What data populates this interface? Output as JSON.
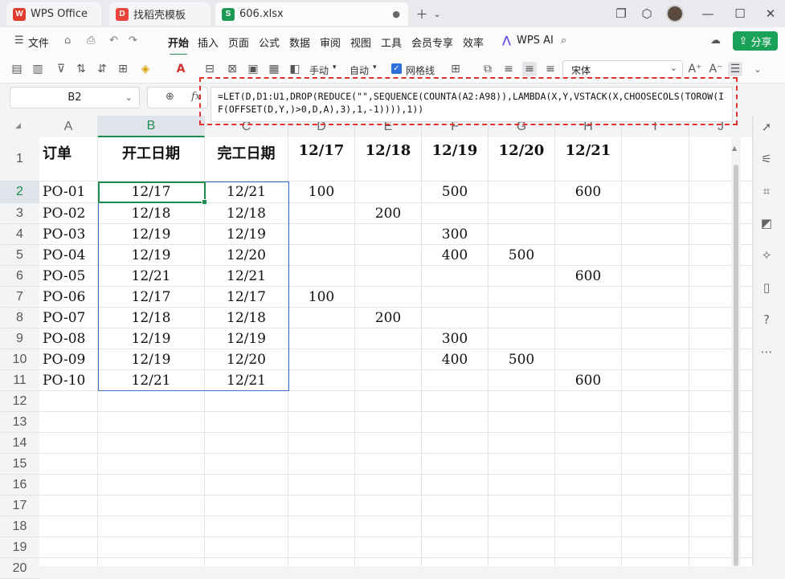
{
  "tabs": [
    {
      "label": "WPS Office",
      "icon": "wps-logo-icon"
    },
    {
      "label": "找稻壳模板",
      "icon": "docer-icon"
    },
    {
      "label": "606.xlsx",
      "icon": "spreadsheet-icon"
    }
  ],
  "menu": {
    "file": "文件",
    "items": [
      "开始",
      "插入",
      "页面",
      "公式",
      "数据",
      "审阅",
      "视图",
      "工具",
      "会员专享",
      "效率"
    ],
    "ai": "WPS AI",
    "share": "分享"
  },
  "toolbar": {
    "wrap": "手动",
    "auto": "自动",
    "gridlines": "网格线",
    "font": "宋体"
  },
  "formula_bar": {
    "name_box": "B2",
    "fx": "fx",
    "formula": "=LET(D,D1:U1,DROP(REDUCE(\"\",SEQUENCE(COUNTA(A2:A98)),LAMBDA(X,Y,VSTACK(X,CHOOSECOLS(TOROW(IF(OFFSET(D,Y,)>0,D,A),3),1,-1)))),1))"
  },
  "columns": [
    "A",
    "B",
    "C",
    "D",
    "E",
    "F",
    "G",
    "H",
    "I",
    "J"
  ],
  "rows": [
    "1",
    "2",
    "3",
    "4",
    "5",
    "6",
    "7",
    "8",
    "9",
    "10",
    "11",
    "12",
    "13",
    "14",
    "15",
    "16",
    "17",
    "18",
    "19",
    "20"
  ],
  "header_row": [
    "订单",
    "开工日期",
    "完工日期",
    "12/17",
    "12/18",
    "12/19",
    "12/20",
    "12/21"
  ],
  "data_rows": [
    [
      "PO-01",
      "12/17",
      "12/21",
      "100",
      "",
      "500",
      "",
      "600"
    ],
    [
      "PO-02",
      "12/18",
      "12/18",
      "",
      "200",
      "",
      "",
      ""
    ],
    [
      "PO-03",
      "12/19",
      "12/19",
      "",
      "",
      "300",
      "",
      ""
    ],
    [
      "PO-04",
      "12/19",
      "12/20",
      "",
      "",
      "400",
      "500",
      ""
    ],
    [
      "PO-05",
      "12/21",
      "12/21",
      "",
      "",
      "",
      "",
      "600"
    ],
    [
      "PO-06",
      "12/17",
      "12/17",
      "100",
      "",
      "",
      "",
      ""
    ],
    [
      "PO-07",
      "12/18",
      "12/18",
      "",
      "200",
      "",
      "",
      ""
    ],
    [
      "PO-08",
      "12/19",
      "12/19",
      "",
      "",
      "300",
      "",
      ""
    ],
    [
      "PO-09",
      "12/19",
      "12/20",
      "",
      "",
      "400",
      "500",
      ""
    ],
    [
      "PO-10",
      "12/21",
      "12/21",
      "",
      "",
      "",
      "",
      "600"
    ]
  ],
  "selected_column": "B",
  "selected_row": "2"
}
